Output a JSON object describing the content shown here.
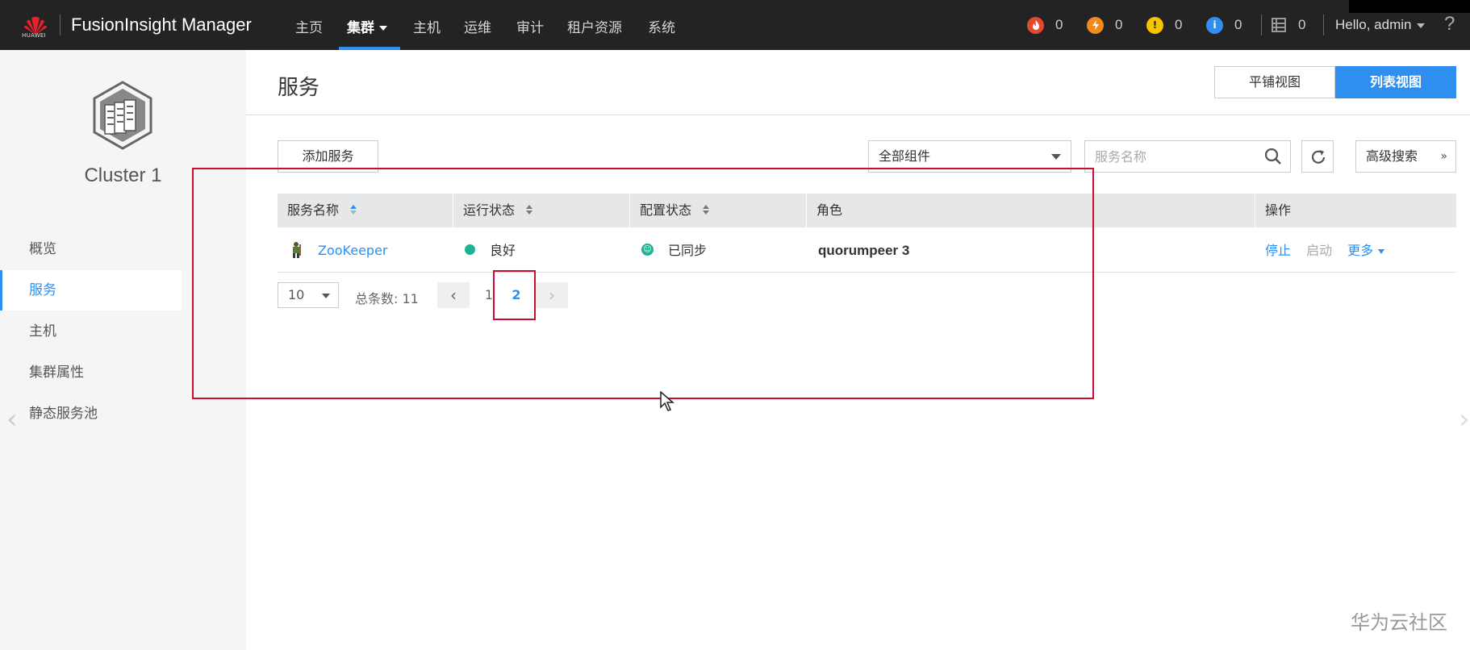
{
  "topbar": {
    "logo_text": "HUAWEI",
    "brand": "FusionInsight Manager",
    "nav": [
      "主页",
      "集群",
      "主机",
      "运维",
      "审计",
      "租户资源",
      "系统"
    ],
    "alarms": [
      {
        "icon": "critical-alarm-icon",
        "color": "#e8492e",
        "count": "0"
      },
      {
        "icon": "major-alarm-icon",
        "color": "#f08a1c",
        "count": "0"
      },
      {
        "icon": "minor-alarm-icon",
        "color": "#f5c400",
        "count": "0"
      },
      {
        "icon": "info-alarm-icon",
        "color": "#2e8ff0",
        "count": "0"
      },
      {
        "icon": "task-list-icon",
        "color": "#888888",
        "count": "0"
      }
    ],
    "user": "Hello, admin",
    "help": "?"
  },
  "sidebar": {
    "cluster_name": "Cluster 1",
    "items": [
      "概览",
      "服务",
      "主机",
      "集群属性",
      "静态服务池"
    ],
    "active": "服务"
  },
  "main": {
    "title": "服务",
    "views": [
      "平铺视图",
      "列表视图"
    ],
    "active_view": "列表视图",
    "add_service": "添加服务",
    "component_filter": "全部组件",
    "search_placeholder": "服务名称",
    "advanced_search": "高级搜索",
    "table": {
      "headers": [
        "服务名称",
        "运行状态",
        "配置状态",
        "角色",
        "操作"
      ],
      "rows": [
        {
          "name": "ZooKeeper",
          "run_status": "良好",
          "config_status": "已同步",
          "role": "quorumpeer 3",
          "actions": [
            "停止",
            "启动",
            "更多"
          ]
        }
      ]
    },
    "pagination": {
      "page_size": "10",
      "total_label": "总条数: 11",
      "pages": [
        "1",
        "2"
      ],
      "current": "2"
    }
  },
  "colors": {
    "accent": "#2e8ff0",
    "good": "#1ab394",
    "annotation": "#c8102e"
  },
  "watermark": "华为云社区"
}
